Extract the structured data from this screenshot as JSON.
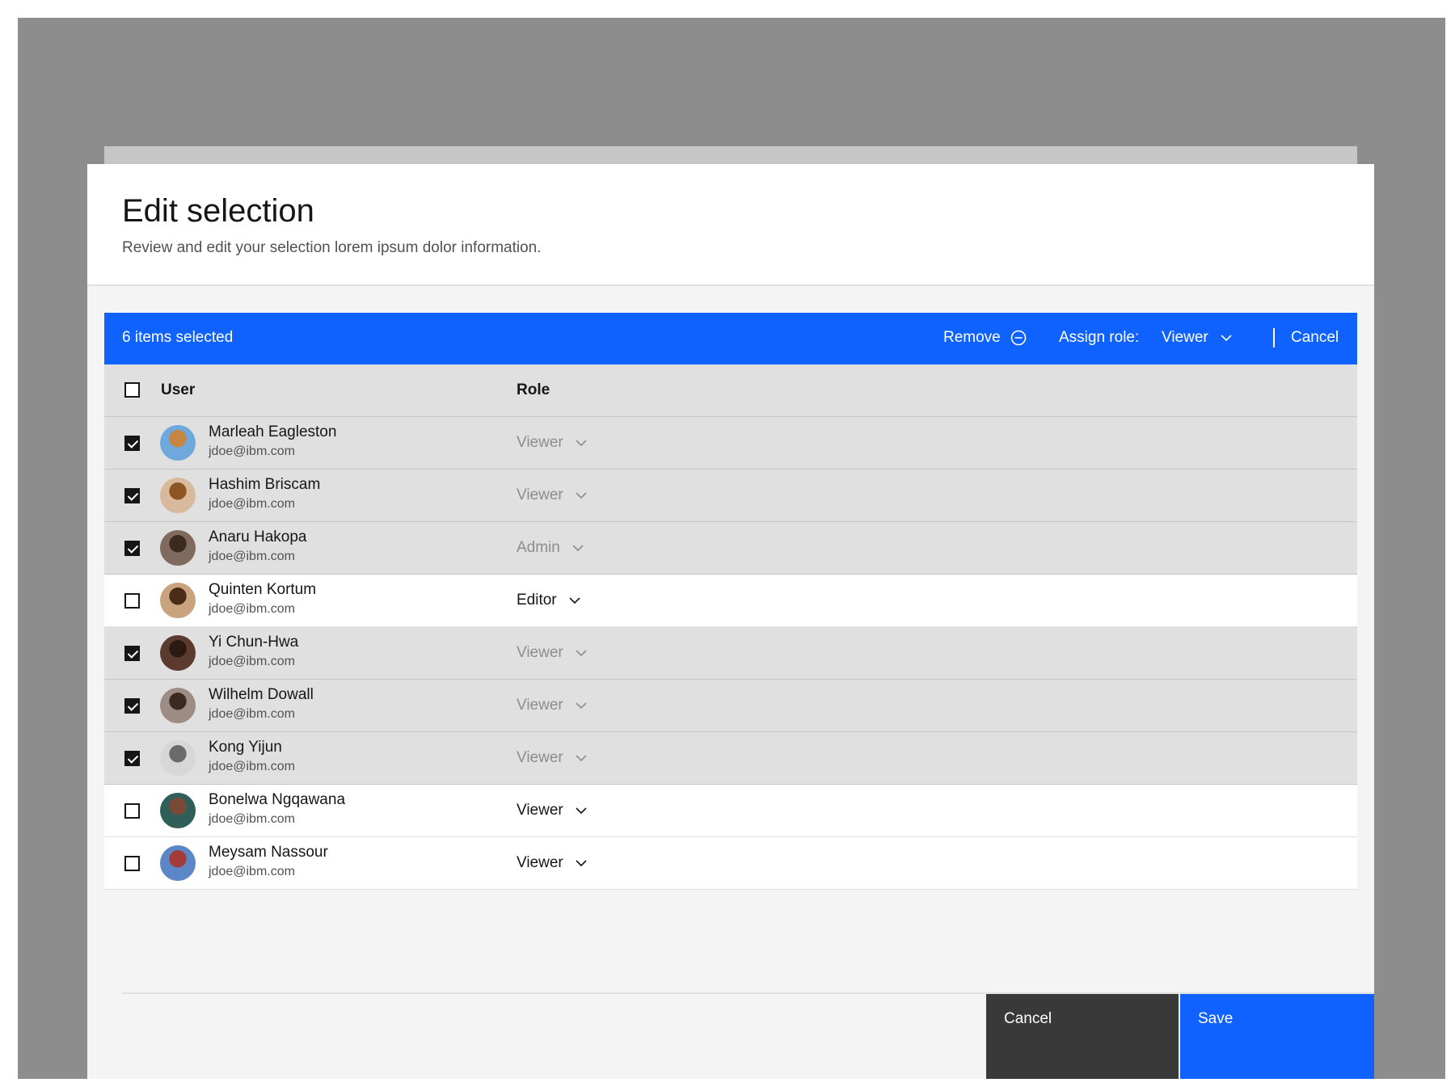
{
  "modal": {
    "title": "Edit selection",
    "description": "Review and edit your selection lorem ipsum dolor information."
  },
  "batch_bar": {
    "count_label": "6 items selected",
    "remove_label": "Remove",
    "assign_role_label": "Assign role:",
    "assign_role_value": "Viewer",
    "cancel_label": "Cancel",
    "color": "#0f62fe"
  },
  "table": {
    "headers": {
      "user": "User",
      "role": "Role"
    },
    "rows": [
      {
        "name": "Marleah Eagleston",
        "email": "jdoe@ibm.com",
        "role": "Viewer",
        "checked": true
      },
      {
        "name": "Hashim Briscam",
        "email": "jdoe@ibm.com",
        "role": "Viewer",
        "checked": true
      },
      {
        "name": "Anaru Hakopa",
        "email": "jdoe@ibm.com",
        "role": "Admin",
        "checked": true
      },
      {
        "name": "Quinten Kortum",
        "email": "jdoe@ibm.com",
        "role": "Editor",
        "checked": false
      },
      {
        "name": "Yi Chun-Hwa",
        "email": "jdoe@ibm.com",
        "role": "Viewer",
        "checked": true
      },
      {
        "name": "Wilhelm Dowall",
        "email": "jdoe@ibm.com",
        "role": "Viewer",
        "checked": true
      },
      {
        "name": "Kong Yijun",
        "email": "jdoe@ibm.com",
        "role": "Viewer",
        "checked": true
      },
      {
        "name": "Bonelwa Ngqawana",
        "email": "jdoe@ibm.com",
        "role": "Viewer",
        "checked": false
      },
      {
        "name": "Meysam Nassour",
        "email": "jdoe@ibm.com",
        "role": "Viewer",
        "checked": false
      }
    ]
  },
  "footer": {
    "cancel_label": "Cancel",
    "save_label": "Save"
  },
  "icons": {
    "remove": "subtract-circle-icon",
    "dropdown": "chevron-down-icon",
    "checkbox": "checkmark-icon"
  }
}
